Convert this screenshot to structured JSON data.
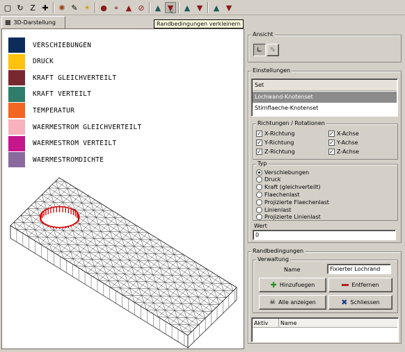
{
  "toolbar": {
    "icons": [
      "view-icon",
      "axis-icon",
      "z-icon",
      "move-icon",
      "sep",
      "material-icon",
      "edit-icon",
      "light-icon",
      "sep",
      "constraint-icon",
      "node-icon",
      "fix-icon",
      "block-icon",
      "sep",
      "boundary-icon",
      "boundary-shrink-icon",
      "sep",
      "load-icon",
      "load2-icon",
      "sep",
      "result-icon",
      "result2-icon"
    ],
    "tooltip": "Randbedingungen verkleinern"
  },
  "tabs": [
    {
      "label": "3D-Darstellung"
    }
  ],
  "legend": [
    {
      "label": "VERSCHIEBUNGEN",
      "color": "#0c2d5c"
    },
    {
      "label": "DRUCK",
      "color": "#ffc20e"
    },
    {
      "label": "KRAFT GLEICHVERTEILT",
      "color": "#7a2830"
    },
    {
      "label": "KRAFT VERTEILT",
      "color": "#2f7d6a"
    },
    {
      "label": "TEMPERATUR",
      "color": "#f26522"
    },
    {
      "label": "WAERMESTROM GLEICHVERTEILT",
      "color": "#f7b2bd"
    },
    {
      "label": "WAERMESTROM VERTEILT",
      "color": "#c6168d"
    },
    {
      "label": "WAERMESTROMDICHTE",
      "color": "#8a6a9e"
    }
  ],
  "panel": {
    "ansicht": {
      "title": "Ansicht"
    },
    "einstellungen": {
      "title": "Einstellungen",
      "list_header": "Set",
      "rows": [
        {
          "label": "Lochwand-Knotenset",
          "selected": true
        },
        {
          "label": "Stirnflaeche-Knotenset",
          "selected": false
        }
      ]
    },
    "richtungen": {
      "title": "Richtungen / Rotationen",
      "items": [
        {
          "label": "X-Richtung",
          "checked": true
        },
        {
          "label": "X-Achse",
          "checked": true
        },
        {
          "label": "Y-Richtung",
          "checked": true
        },
        {
          "label": "Y-Achse",
          "checked": true
        },
        {
          "label": "Z-Richtung",
          "checked": true
        },
        {
          "label": "Z-Achse",
          "checked": true
        }
      ]
    },
    "typ": {
      "title": "Typ",
      "options": [
        {
          "label": "Verschiebungen",
          "selected": true
        },
        {
          "label": "Druck",
          "selected": false
        },
        {
          "label": "Kraft (gleichverteilt)",
          "selected": false
        },
        {
          "label": "Flaechenlast",
          "selected": false
        },
        {
          "label": "Projizierte Flaechenlast",
          "selected": false
        },
        {
          "label": "Linienlast",
          "selected": false
        },
        {
          "label": "Projizierte Linienlast",
          "selected": false
        }
      ]
    },
    "wert": {
      "title": "Wert",
      "value": "0"
    },
    "randbedingungen": {
      "title": "Randbedingungen",
      "verwaltung": "Verwaltung",
      "name_label": "Name",
      "name_value": "Fixierter Lochrand",
      "buttons": {
        "add": "Hinzufuegen",
        "remove": "Entfernen",
        "show_all": "Alle anzeigen",
        "close": "Schliessen"
      },
      "table_headers": [
        "Aktiv",
        "Name"
      ]
    }
  },
  "colors": {
    "selection": "#8c8c8c",
    "hole_highlight": "#d40000",
    "add_icon": "#2a8a2a",
    "remove_icon": "#b02020",
    "close_icon": "#1a3e8a"
  }
}
